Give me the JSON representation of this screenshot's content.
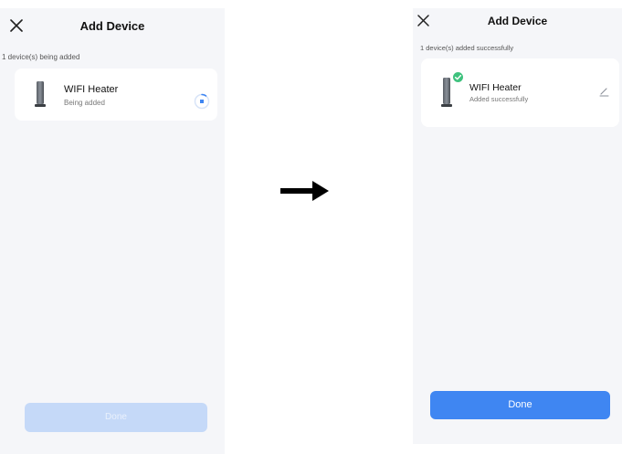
{
  "before": {
    "title": "Add Device",
    "status": "1 device(s) being added",
    "device": {
      "name": "WIFI Heater",
      "state": "Being added"
    },
    "done_label": "Done",
    "done_enabled": false
  },
  "after": {
    "title": "Add Device",
    "status": "1 device(s) added successfully",
    "device": {
      "name": "WIFI Heater",
      "state": "Added successfully"
    },
    "done_label": "Done",
    "done_enabled": true
  },
  "icons": {
    "close": "close-icon",
    "device": "heater-icon",
    "loading": "spinner-icon",
    "success": "check-icon",
    "edit": "edit-icon",
    "transition": "arrow-right-icon"
  },
  "colors": {
    "background": "#f5f6f9",
    "card": "#ffffff",
    "accent": "#3f86f2",
    "accent_disabled": "#c5d9f8",
    "success": "#3fc27e"
  }
}
